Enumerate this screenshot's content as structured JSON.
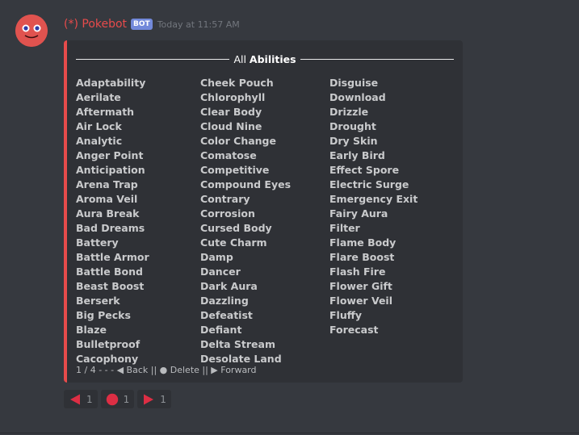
{
  "message": {
    "username": "(*) Pokebot",
    "bot_tag": "BOT",
    "timestamp": "Today at 11:57 AM"
  },
  "embed": {
    "title_prefix": "All",
    "title_bold": "Abilities",
    "accent_color": "#e74b4b",
    "columns": [
      [
        "Adaptability",
        "Aerilate",
        "Aftermath",
        "Air Lock",
        "Analytic",
        "Anger Point",
        "Anticipation",
        "Arena Trap",
        "Aroma Veil",
        "Aura Break",
        "Bad Dreams",
        "Battery",
        "Battle Armor",
        "Battle Bond",
        "Beast Boost",
        "Berserk",
        "Big Pecks",
        "Blaze",
        "Bulletproof",
        "Cacophony"
      ],
      [
        "Cheek Pouch",
        "Chlorophyll",
        "Clear Body",
        "Cloud Nine",
        "Color Change",
        "Comatose",
        "Competitive",
        "Compound Eyes",
        "Contrary",
        "Corrosion",
        "Cursed Body",
        "Cute Charm",
        "Damp",
        "Dancer",
        "Dark Aura",
        "Dazzling",
        "Defeatist",
        "Defiant",
        "Delta Stream",
        "Desolate Land"
      ],
      [
        "Disguise",
        "Download",
        "Drizzle",
        "Drought",
        "Dry Skin",
        "Early Bird",
        "Effect Spore",
        "Electric Surge",
        "Emergency Exit",
        "Fairy Aura",
        "Filter",
        "Flame Body",
        "Flare Boost",
        "Flash Fire",
        "Flower Gift",
        "Flower Veil",
        "Fluffy",
        "Forecast"
      ]
    ],
    "footer": "1 / 4 - - - ◀ Back || ● Delete || ▶ Forward"
  },
  "reactions": [
    {
      "icon": "left-triangle-icon",
      "count": "1",
      "color": "#dd2e44"
    },
    {
      "icon": "red-circle-icon",
      "count": "1",
      "color": "#dd2e44"
    },
    {
      "icon": "right-triangle-icon",
      "count": "1",
      "color": "#dd2e44"
    }
  ]
}
